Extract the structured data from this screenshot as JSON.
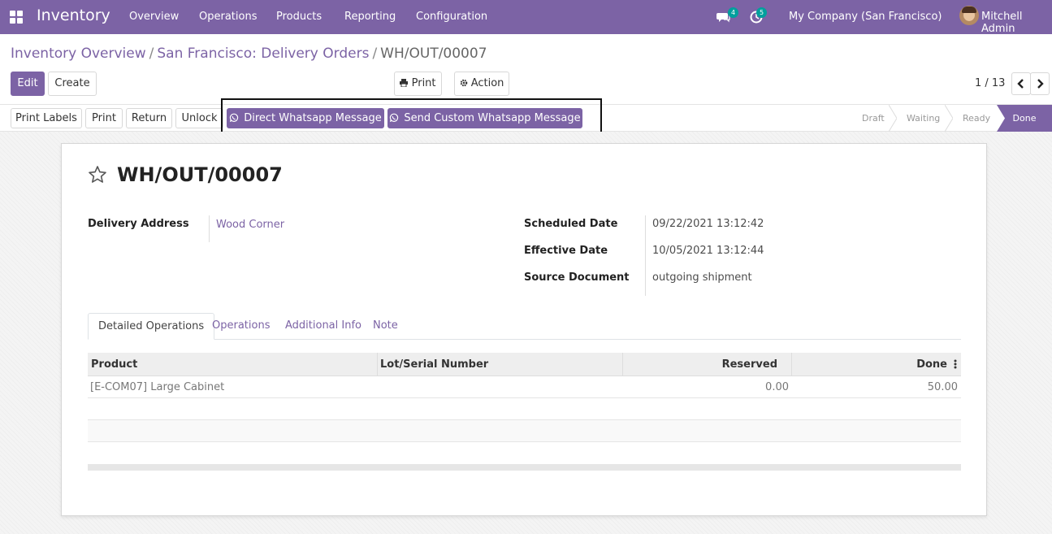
{
  "navbar": {
    "app_name": "Inventory",
    "menu": [
      "Overview",
      "Operations",
      "Products",
      "Reporting",
      "Configuration"
    ],
    "messages_count": "4",
    "activities_count": "5",
    "company": "My Company (San Francisco)",
    "user": "Mitchell Admin"
  },
  "breadcrumb": {
    "items": [
      "Inventory Overview",
      "San Francisco: Delivery Orders"
    ],
    "separator": "/",
    "current": "WH/OUT/00007"
  },
  "control_panel": {
    "edit_label": "Edit",
    "create_label": "Create",
    "print_label": "Print",
    "action_label": "Action",
    "pager": "1 / 13"
  },
  "statusbar": {
    "buttons": [
      "Print Labels",
      "Print",
      "Return",
      "Unlock"
    ],
    "whatsapp_direct": "Direct Whatsapp Message",
    "whatsapp_custom": "Send Custom Whatsapp Message",
    "stages": [
      "Draft",
      "Waiting",
      "Ready",
      "Done"
    ],
    "current_stage": "Done"
  },
  "record": {
    "title": "WH/OUT/00007",
    "delivery_address_label": "Delivery Address",
    "delivery_address": "Wood Corner",
    "scheduled_date_label": "Scheduled Date",
    "scheduled_date": "09/22/2021 13:12:42",
    "effective_date_label": "Effective Date",
    "effective_date": "10/05/2021 13:12:44",
    "source_document_label": "Source Document",
    "source_document": "outgoing shipment"
  },
  "tabs": [
    "Detailed Operations",
    "Operations",
    "Additional Info",
    "Note"
  ],
  "table": {
    "columns": [
      "Product",
      "Lot/Serial Number",
      "Reserved",
      "Done"
    ],
    "rows": [
      {
        "product": "[E-COM07] Large Cabinet",
        "lot": "",
        "reserved": "0.00",
        "done": "50.00"
      }
    ]
  },
  "colors": {
    "brand": "#7c63a5",
    "badge": "#00a09d"
  }
}
